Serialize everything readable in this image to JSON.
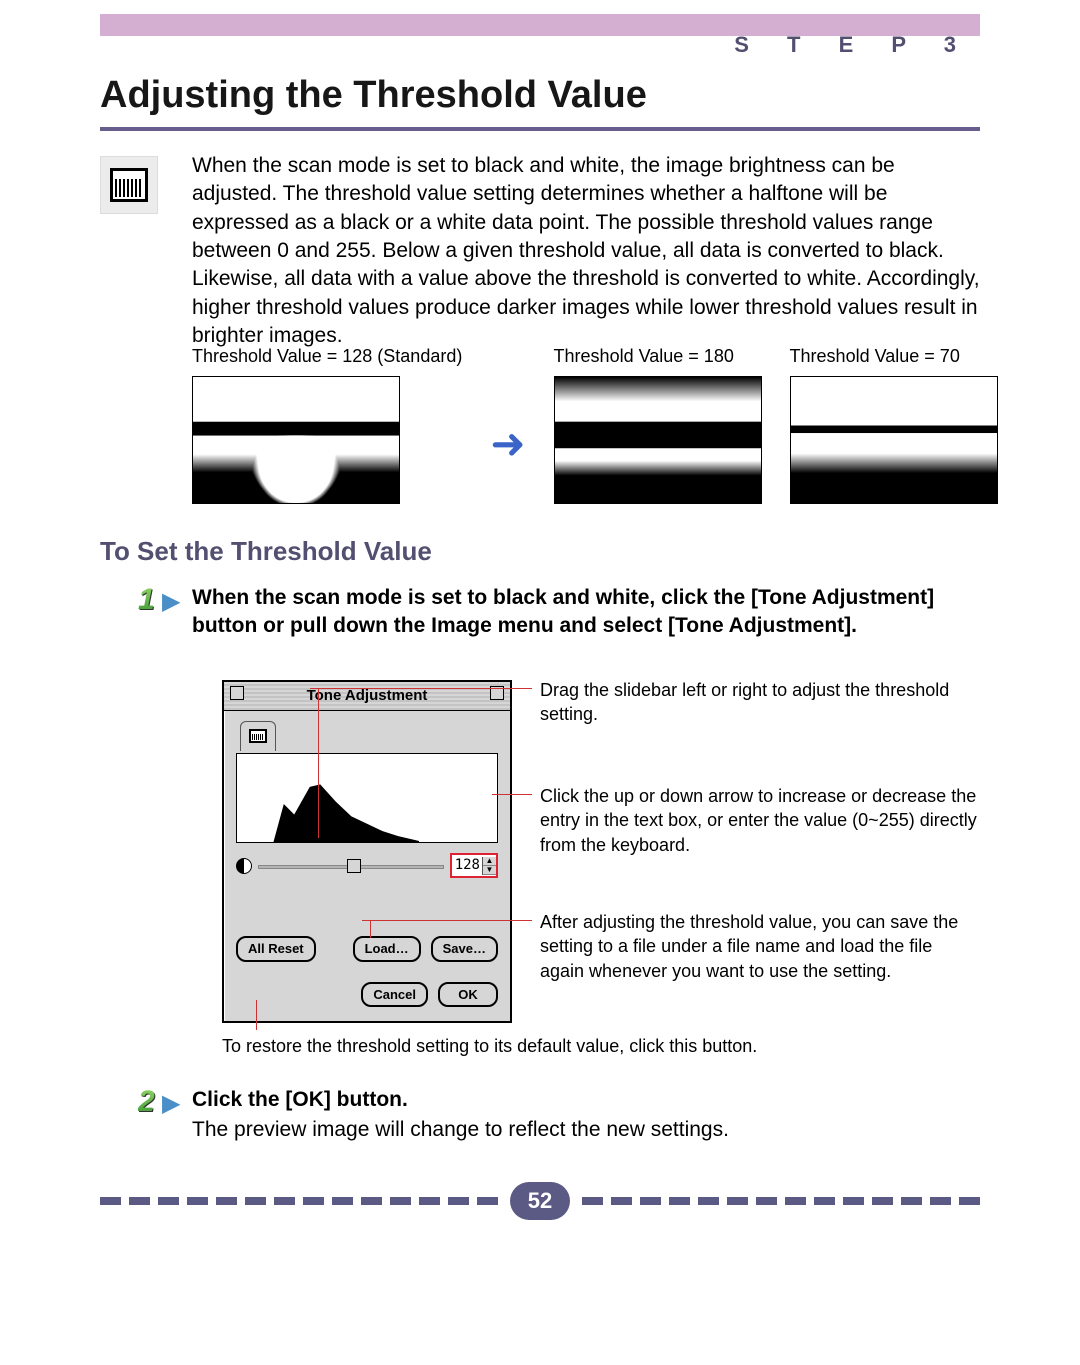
{
  "header": {
    "step_label": "S T E P   3",
    "title": "Adjusting the Threshold Value"
  },
  "intro": {
    "text": "When the scan mode is set to black and white, the image brightness can be adjusted. The threshold value setting determines whether a halftone will be expressed as a black or a white data point. The possible threshold values range between 0 and 255. Below a given threshold value, all data is converted to black. Likewise, all data with a value above the threshold is converted to white. Accordingly, higher threshold values produce darker images while lower threshold values result in brighter images."
  },
  "examples": {
    "labels": [
      "Threshold Value = 128 (Standard)",
      "Threshold Value = 180",
      "Threshold Value = 70"
    ]
  },
  "section_subtitle": "To Set the Threshold Value",
  "steps": {
    "one": {
      "num": "1",
      "text": "When the scan mode is set to black and white, click the [Tone Adjustment] button or pull down the Image menu and select [Tone Adjustment]."
    },
    "two": {
      "num": "2",
      "head": "Click the [OK] button.",
      "text": "The preview image will change to reflect the new settings."
    }
  },
  "dialog": {
    "title": "Tone Adjustment",
    "value": "128",
    "buttons": {
      "all_reset": "All Reset",
      "load": "Load…",
      "save": "Save…",
      "cancel": "Cancel",
      "ok": "OK"
    }
  },
  "callouts": {
    "slider": "Drag the slidebar left or right to adjust the threshold setting.",
    "spinner": "Click the up or down arrow to increase or decrease the entry in the text box, or enter the value (0~255) directly from the keyboard.",
    "save": "After adjusting the threshold value, you can save the setting to a file under a file name and load the file again whenever you want to use the setting.",
    "reset": "To restore the threshold setting to its default value, click this button."
  },
  "footer": {
    "page": "52"
  }
}
